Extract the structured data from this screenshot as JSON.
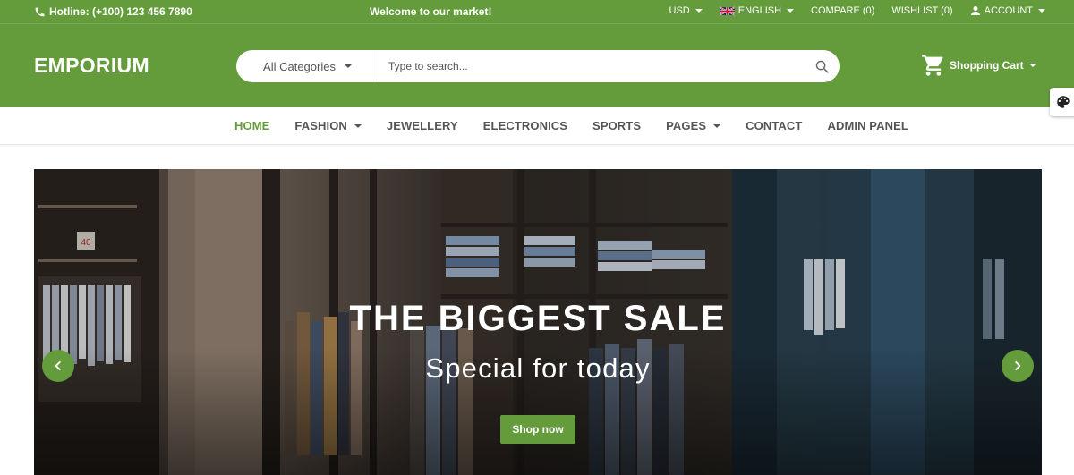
{
  "colors": {
    "brand": "#649c3b",
    "white": "#ffffff",
    "nav_text": "#555555"
  },
  "topbar": {
    "hotline": "Hotline: (+100) 123 456 7890",
    "welcome": "Welcome to our market!",
    "currency": "USD",
    "language": "ENGLISH",
    "compare": "COMPARE (0)",
    "wishlist": "WISHLIST (0)",
    "account": "ACCOUNT"
  },
  "header": {
    "logo": "EMPORIUM",
    "category_selected": "All Categories",
    "search_placeholder": "Type to search...",
    "cart_label": "Shopping Cart"
  },
  "nav": {
    "items": [
      {
        "label": "HOME",
        "active": true,
        "dropdown": false
      },
      {
        "label": "FASHION",
        "active": false,
        "dropdown": true
      },
      {
        "label": "JEWELLERY",
        "active": false,
        "dropdown": false
      },
      {
        "label": "ELECTRONICS",
        "active": false,
        "dropdown": false
      },
      {
        "label": "SPORTS",
        "active": false,
        "dropdown": false
      },
      {
        "label": "PAGES",
        "active": false,
        "dropdown": true
      },
      {
        "label": "CONTACT",
        "active": false,
        "dropdown": false
      },
      {
        "label": "ADMIN PANEL",
        "active": false,
        "dropdown": false
      }
    ]
  },
  "hero": {
    "title": "THE BIGGEST SALE",
    "subtitle": "Special for today",
    "button": "Shop now",
    "sign_text": "40"
  },
  "icons": {
    "phone": "phone-icon",
    "flag": "uk-flag-icon",
    "user": "user-icon",
    "search": "search-icon",
    "cart": "cart-icon",
    "palette": "palette-icon",
    "prev": "chevron-left-icon",
    "next": "chevron-right-icon"
  }
}
